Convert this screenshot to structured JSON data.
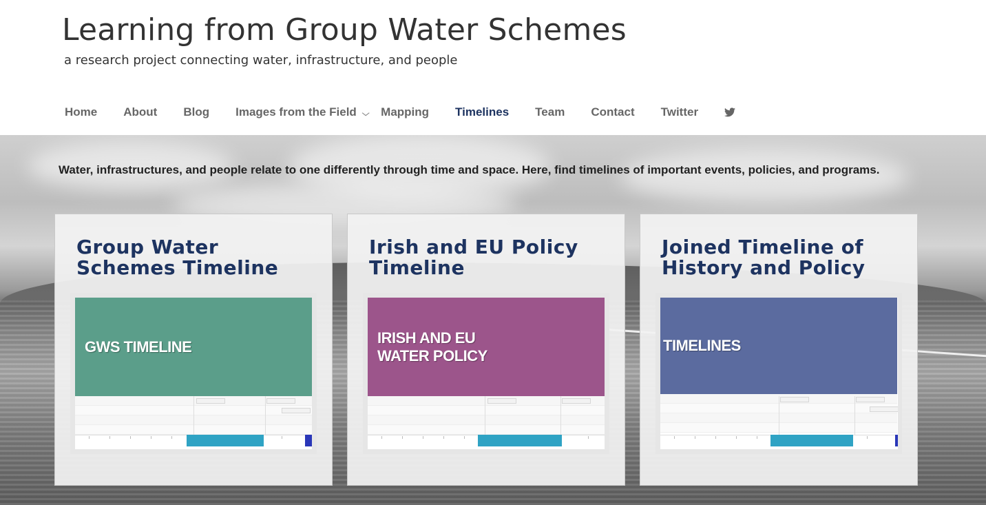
{
  "site": {
    "title": "Learning from Group Water Schemes",
    "tagline": "a research project connecting water, infrastructure, and people"
  },
  "nav": {
    "items": [
      {
        "label": "Home",
        "active": false
      },
      {
        "label": "About",
        "active": false
      },
      {
        "label": "Blog",
        "active": false
      },
      {
        "label": "Images from the Field",
        "active": false,
        "has_submenu": true
      },
      {
        "label": "Mapping",
        "active": false
      },
      {
        "label": "Timelines",
        "active": true
      },
      {
        "label": "Team",
        "active": false
      },
      {
        "label": "Contact",
        "active": false
      },
      {
        "label": "Twitter",
        "active": false
      }
    ],
    "twitter_icon": "twitter-bird-icon"
  },
  "intro": "Water, infrastructures, and people relate to one differently through time and space. Here, find timelines of important events, policies, and programs.",
  "cards": [
    {
      "title": "Group Water Schemes Timeline",
      "banner": "GWS TIMELINE",
      "banner_color": "#5b9e8a"
    },
    {
      "title": "Irish and EU Policy Timeline",
      "banner": "IRISH AND EU WATER POLICY",
      "banner_color": "#9c558b"
    },
    {
      "title": "Joined Timeline of History and Policy",
      "banner": "TIMELINES",
      "banner_color": "#5b6b9f"
    }
  ],
  "colors": {
    "accent": "#1d3360",
    "nav_text": "#666666",
    "timeline_bar": "#2fa3c4"
  }
}
